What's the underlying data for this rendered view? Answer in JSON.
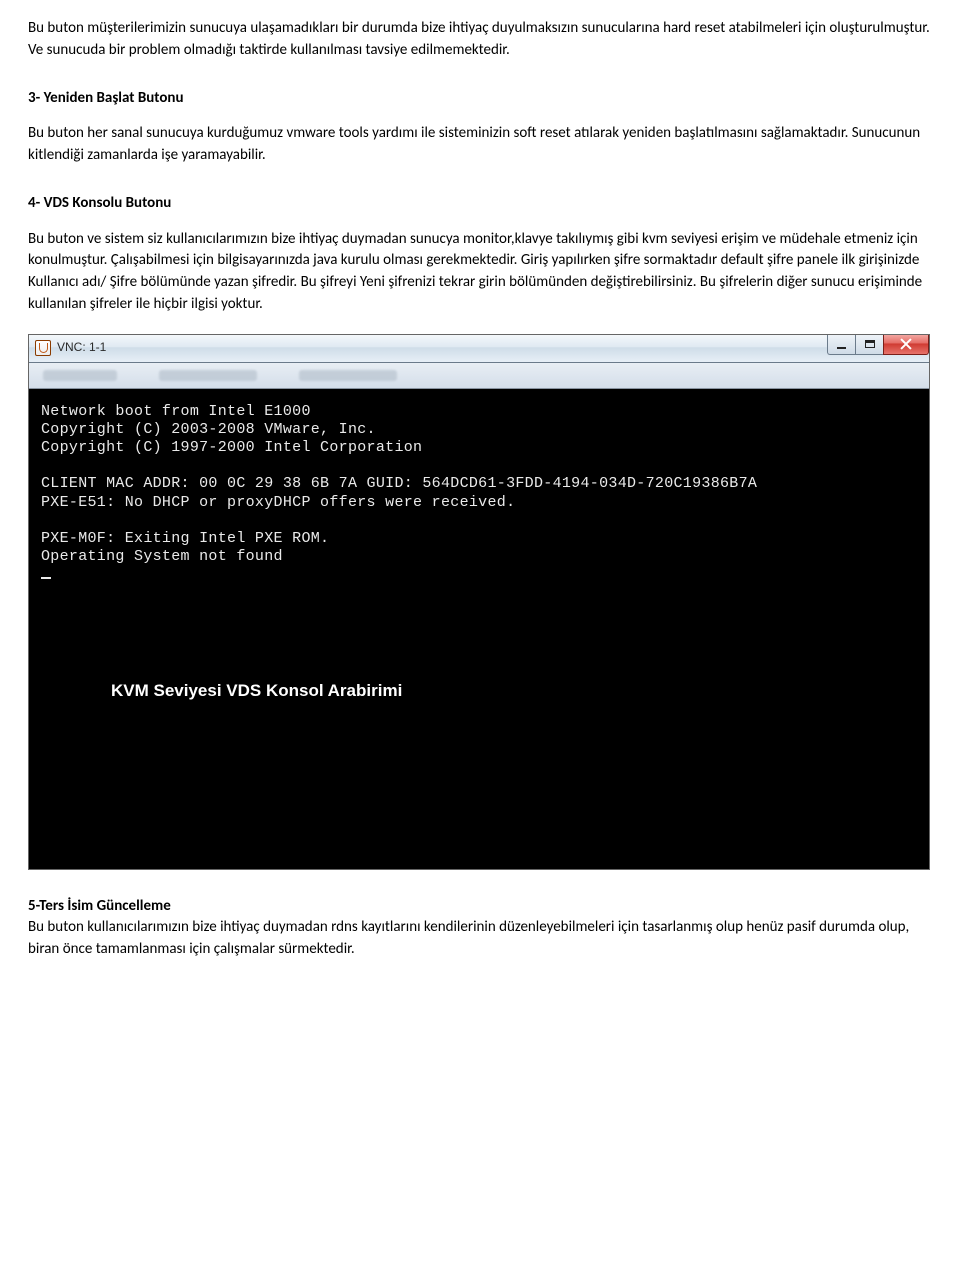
{
  "intro": {
    "p1": "Bu buton müşterilerimizin sunucuya ulaşamadıkları bir durumda bize ihtiyaç duyulmaksızın sunucularına hard reset atabilmeleri için oluşturulmuştur. Ve sunucuda bir problem olmadığı taktirde kullanılması tavsiye edilmemektedir."
  },
  "section3": {
    "title": "3- Yeniden Başlat Butonu",
    "p1": "Bu buton her sanal sunucuya kurduğumuz vmware tools yardımı ile sisteminizin soft reset atılarak yeniden başlatılmasını sağlamaktadır. Sunucunun kitlendiği zamanlarda işe yaramayabilir."
  },
  "section4": {
    "title": "4- VDS Konsolu Butonu",
    "p1": "Bu buton ve sistem siz kullanıcılarımızın bize ihtiyaç duymadan sunucya monitor,klavye takılıymış gibi kvm seviyesi erişim ve müdehale etmeniz için konulmuştur. Çalışabilmesi için bilgisayarınızda java kurulu olması gerekmektedir. Giriş yapılırken şifre sormaktadır default şifre panele ilk girişinizde Kullanıcı adı/ Şifre bölümünde yazan şifredir. Bu şifreyi Yeni şifrenizi tekrar girin bölümünden değiştirebilirsiniz. Bu şifrelerin diğer sunucu erişiminde kullanılan şifreler ile hiçbir ilgisi yoktur."
  },
  "vnc": {
    "window_title": "VNC: 1-1",
    "console_lines": {
      "l1": "Network boot from Intel E1000",
      "l2": "Copyright (C) 2003-2008  VMware, Inc.",
      "l3": "Copyright (C) 1997-2000  Intel Corporation",
      "l4": "CLIENT MAC ADDR: 00 0C 29 38 6B 7A  GUID: 564DCD61-3FDD-4194-034D-720C19386B7A",
      "l5": "PXE-E51: No DHCP or proxyDHCP offers were received.",
      "l6": "PXE-M0F: Exiting Intel PXE ROM.",
      "l7": "Operating System not found"
    },
    "caption": "KVM Seviyesi VDS Konsol Arabirimi"
  },
  "section5": {
    "title": "5-Ters İsim Güncelleme",
    "p1": "Bu buton kullanıcılarımızın bize ihtiyaç duymadan rdns kayıtlarını kendilerinin düzenleyebilmeleri için tasarlanmış olup henüz pasif durumda olup, biran önce tamamlanması için çalışmalar sürmektedir."
  }
}
